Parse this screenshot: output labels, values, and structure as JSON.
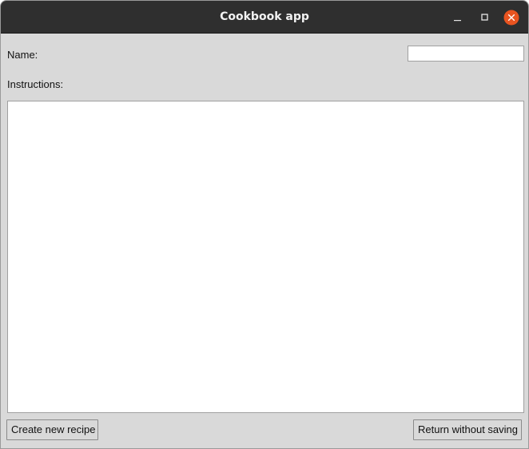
{
  "window": {
    "title": "Cookbook app",
    "controls": {
      "minimize_icon": "minimize-icon",
      "maximize_icon": "maximize-icon",
      "close_icon": "close-icon",
      "close_color": "#e95420"
    }
  },
  "form": {
    "name_label": "Name:",
    "name_value": "",
    "instructions_label": "Instructions:",
    "instructions_value": ""
  },
  "buttons": {
    "create_label": "Create new recipe",
    "return_label": "Return without saving"
  }
}
